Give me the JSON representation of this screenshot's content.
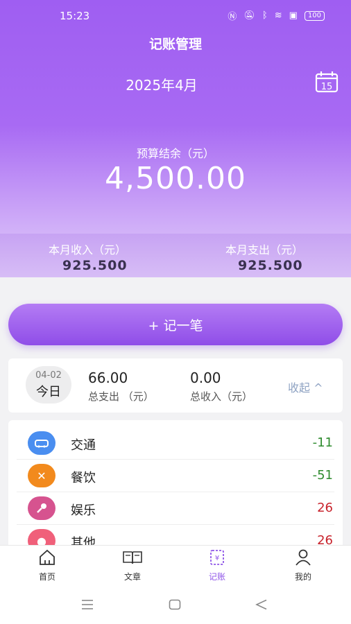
{
  "status": {
    "time": "15:23",
    "battery": "100"
  },
  "header": {
    "title": "记账管理",
    "month": "2025年4月",
    "calendar_day": "15"
  },
  "budget": {
    "label": "预算结余（元）",
    "value": "4,500.00"
  },
  "summary": {
    "income_label": "本月收入（元）",
    "income_value": "925.500",
    "expense_label": "本月支出（元）",
    "expense_value": "925.500"
  },
  "add_button": {
    "label": "+ 记一笔"
  },
  "day": {
    "date": "04-02",
    "today": "今日",
    "expense_value": "66.00",
    "expense_label": "总支出 （元）",
    "income_value": "0.00",
    "income_label": "总收入（元）",
    "collapse_label": "收起 ^"
  },
  "entries": [
    {
      "name": "交通",
      "amount": "-11",
      "icon": "car-icon",
      "icon_color": "#4a8ef0",
      "amount_color": "#2e8b2e"
    },
    {
      "name": "餐饮",
      "amount": "-51",
      "icon": "fork-knife-icon",
      "icon_color": "#f28a1d",
      "amount_color": "#2e8b2e"
    },
    {
      "name": "娱乐",
      "amount": "26",
      "icon": "microphone-icon",
      "icon_color": "#d6538f",
      "amount_color": "#c8232c"
    },
    {
      "name": "其他",
      "amount": "26",
      "icon": "other-icon",
      "icon_color": "#f0607a",
      "amount_color": "#c8232c"
    }
  ],
  "tabs": [
    {
      "label": "首页",
      "icon": "home-icon"
    },
    {
      "label": "文章",
      "icon": "book-icon"
    },
    {
      "label": "记账",
      "icon": "ledger-icon"
    },
    {
      "label": "我的",
      "icon": "person-icon"
    }
  ],
  "colors": {
    "accent": "#8f55e8",
    "hero_top": "#9f5ef2"
  }
}
